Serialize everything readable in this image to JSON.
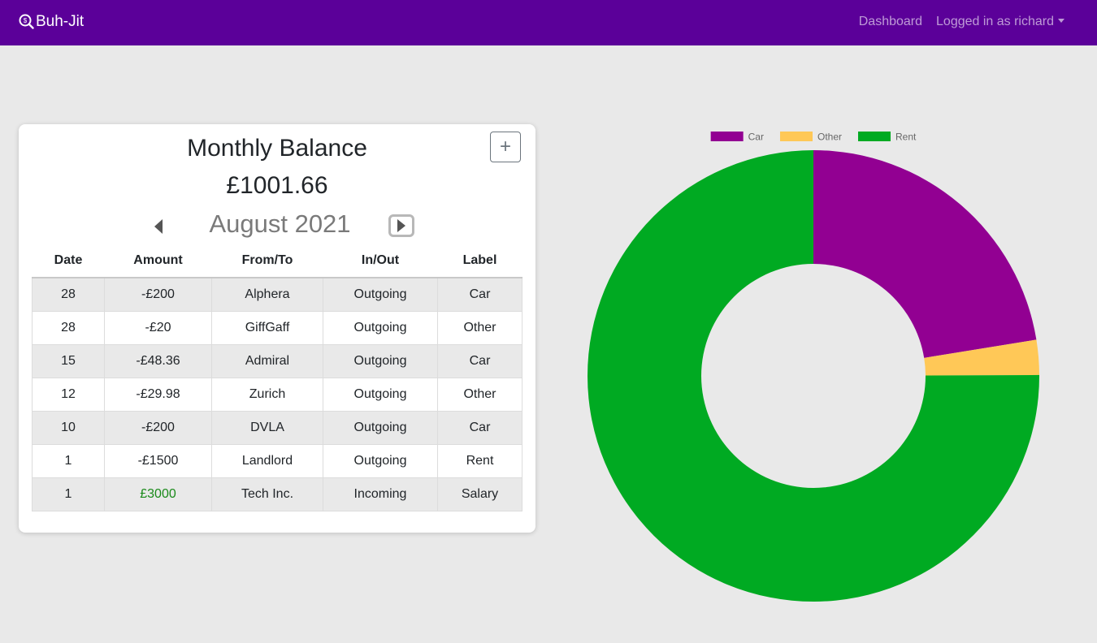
{
  "navbar": {
    "brand": "Buh-Jit",
    "dashboard": "Dashboard",
    "user_menu": "Logged in as richard",
    "color": "#5b0099"
  },
  "card": {
    "title": "Monthly Balance",
    "balance": "£1001.66",
    "add_label": "+",
    "month": "August 2021",
    "columns": [
      "Date",
      "Amount",
      "From/To",
      "In/Out",
      "Label"
    ],
    "rows": [
      {
        "date": "28",
        "amount": "-£200",
        "party": "Alphera",
        "direction": "Outgoing",
        "label": "Car"
      },
      {
        "date": "28",
        "amount": "-£20",
        "party": "GiffGaff",
        "direction": "Outgoing",
        "label": "Other"
      },
      {
        "date": "15",
        "amount": "-£48.36",
        "party": "Admiral",
        "direction": "Outgoing",
        "label": "Car"
      },
      {
        "date": "12",
        "amount": "-£29.98",
        "party": "Zurich",
        "direction": "Outgoing",
        "label": "Other"
      },
      {
        "date": "10",
        "amount": "-£200",
        "party": "DVLA",
        "direction": "Outgoing",
        "label": "Car"
      },
      {
        "date": "1",
        "amount": "-£1500",
        "party": "Landlord",
        "direction": "Outgoing",
        "label": "Rent"
      },
      {
        "date": "1",
        "amount": "£3000",
        "party": "Tech Inc.",
        "direction": "Incoming",
        "label": "Salary"
      }
    ]
  },
  "chart_data": {
    "type": "pie",
    "categories": [
      "Car",
      "Other",
      "Rent"
    ],
    "values": [
      448.36,
      49.98,
      1500
    ],
    "colors": [
      "#920092",
      "#ffc857",
      "#00aa22"
    ],
    "legend": "top",
    "donut": true
  }
}
